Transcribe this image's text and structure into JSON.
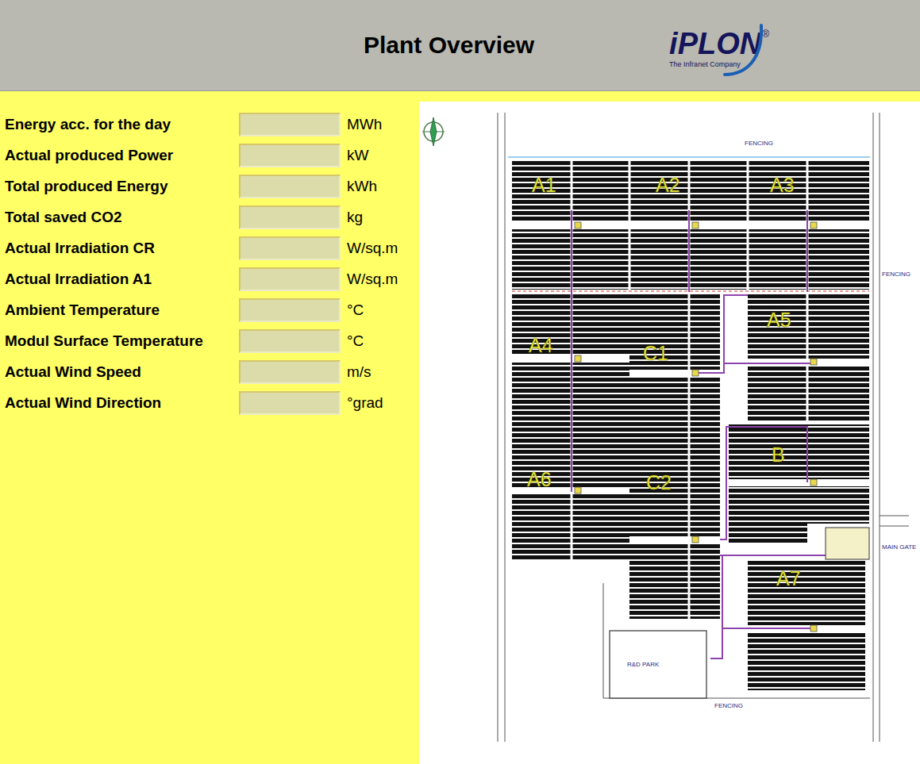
{
  "header": {
    "title": "Plant Overview",
    "logo": {
      "brand": "iPLON",
      "registered": "®",
      "tagline": "The Infranet Company"
    }
  },
  "readings": [
    {
      "label": "Energy acc. for the day",
      "value": "",
      "unit": "MWh"
    },
    {
      "label": "Actual produced Power",
      "value": "",
      "unit": "kW"
    },
    {
      "label": "Total produced Energy",
      "value": "",
      "unit": "kWh"
    },
    {
      "label": "Total saved CO2",
      "value": "",
      "unit": "kg"
    },
    {
      "label": "Actual Irradiation CR",
      "value": "",
      "unit": "W/sq.m"
    },
    {
      "label": "Actual Irradiation A1",
      "value": "",
      "unit": "W/sq.m"
    },
    {
      "label": "Ambient Temperature",
      "value": "",
      "unit": "°C"
    },
    {
      "label": "Modul Surface Temperature",
      "value": "",
      "unit": "°C"
    },
    {
      "label": "Actual Wind Speed",
      "value": "",
      "unit": "m/s"
    },
    {
      "label": "Actual Wind Direction",
      "value": "",
      "unit": "°grad"
    }
  ],
  "plant_map": {
    "blocks": [
      {
        "label": "A1"
      },
      {
        "label": "A2"
      },
      {
        "label": "A3"
      },
      {
        "label": "A4"
      },
      {
        "label": "C1"
      },
      {
        "label": "A5"
      },
      {
        "label": "B"
      },
      {
        "label": "A6"
      },
      {
        "label": "C2"
      },
      {
        "label": "A7"
      }
    ],
    "annotations": [
      {
        "text": "FENCING"
      },
      {
        "text": "FENCING"
      },
      {
        "text": "FENCING"
      },
      {
        "text": "R&D PARK"
      },
      {
        "text": "MAIN GATE"
      }
    ]
  }
}
